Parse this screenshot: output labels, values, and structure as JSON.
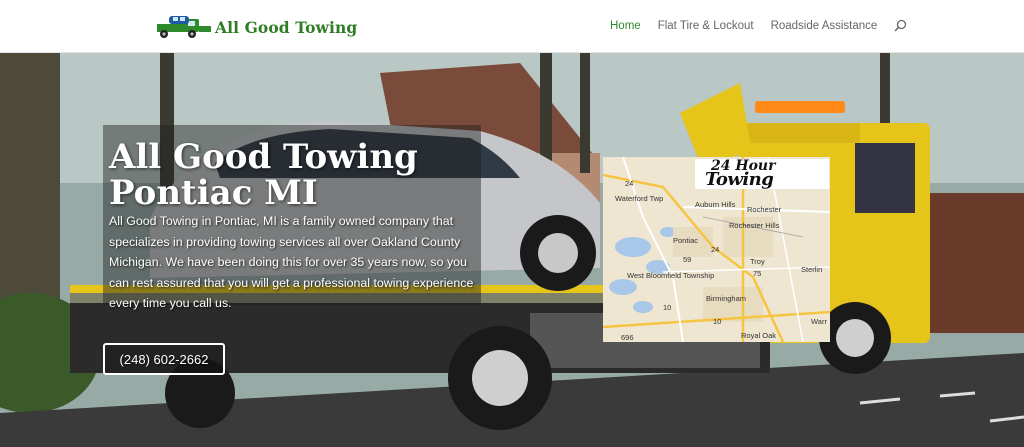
{
  "header": {
    "logo_text": "All Good Towing",
    "nav": [
      {
        "label": "Home",
        "active": true
      },
      {
        "label": "Flat Tire & Lockout",
        "active": false
      },
      {
        "label": "Roadside Assistance",
        "active": false
      }
    ],
    "search_icon": "search-icon"
  },
  "hero": {
    "title_line1": "All Good Towing",
    "title_line2": "Pontiac MI",
    "description": "All Good Towing in Pontiac, MI is a family owned company that specializes in providing towing services all over Oakland County Michigan. We have been doing this for over 35 years now, so you can rest assured that you will get a professional towing experience every time you call us.",
    "phone": "(248) 602-2662"
  },
  "map": {
    "banner_top": "24 Hour",
    "banner_bottom": "Towing",
    "places": [
      "Waterford Twp",
      "Auburn Hills",
      "Rochester",
      "Rochester Hills",
      "Pontiac",
      "Troy",
      "West Bloomfield Township",
      "Birmingham",
      "Sterlin",
      "Royal Oak",
      "Warr"
    ],
    "routes": [
      "24",
      "59",
      "24",
      "10",
      "75",
      "10",
      "696"
    ]
  },
  "colors": {
    "brand_green": "#2f7d25",
    "nav_active": "#2e8a2e",
    "truck_yellow": "#e6c51b"
  }
}
